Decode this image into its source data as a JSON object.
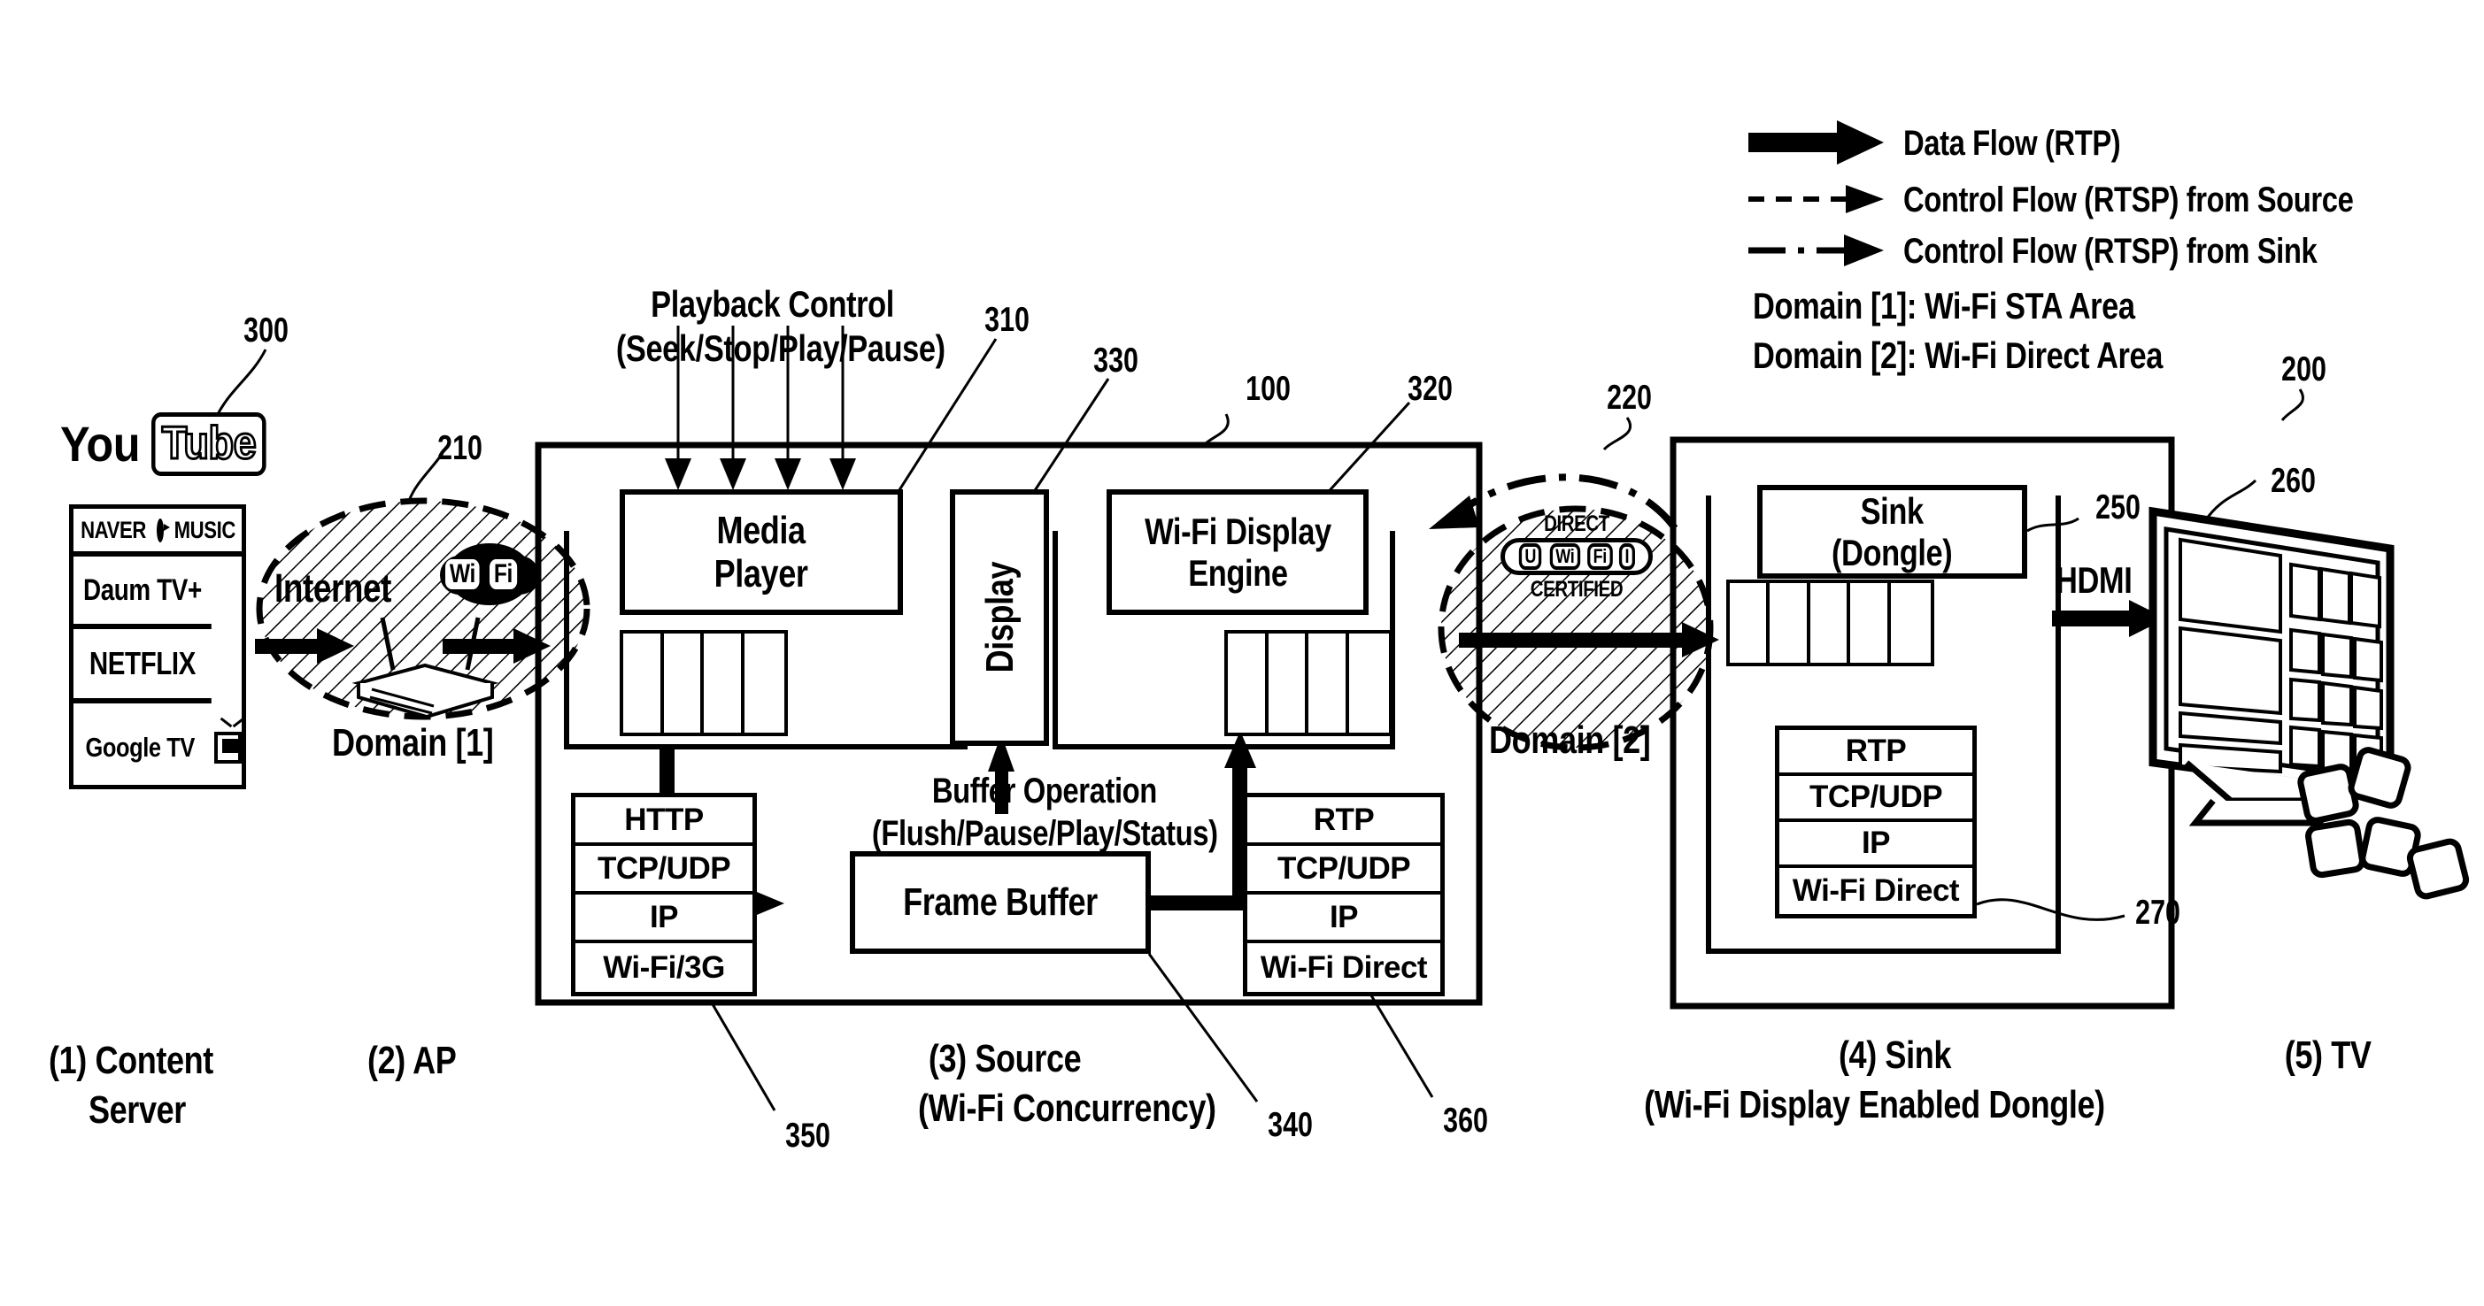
{
  "legend": {
    "items": [
      {
        "icon": "thick-block-arrow-icon",
        "label": "Data Flow (RTP)"
      },
      {
        "icon": "dashed-arrow-icon",
        "label": "Control Flow (RTSP) from Source"
      },
      {
        "icon": "dash-dot-arrow-icon",
        "label": "Control Flow (RTSP) from Sink"
      }
    ],
    "domains": [
      "Domain [1]: Wi-Fi STA Area",
      "Domain [2]: Wi-Fi Direct Area"
    ]
  },
  "content_server": {
    "ref": "300",
    "logo": "YouTube",
    "logo_part1": "You",
    "logo_part2": "Tube",
    "services": [
      "NAVER",
      "MUSIC",
      "Daum  TV+",
      "NETFLIX",
      "Google TV"
    ],
    "naver_left": "NAVER",
    "naver_right": "MUSIC",
    "daum": "Daum  TV+",
    "netflix": "NETFLIX",
    "googletv": "Google TV",
    "caption_line1": "(1) Content",
    "caption_line2": "Server"
  },
  "ap": {
    "ref": "210",
    "internet_label": "Internet",
    "wifi_badge": "Wi Fi",
    "wifi_badge_left": "Wi",
    "wifi_badge_right": "Fi",
    "domain_label": "Domain [1]",
    "caption": "(2) AP"
  },
  "source": {
    "ref": "100",
    "playback_control_line1": "Playback Control",
    "playback_control_line2": "(Seek/Stop/Play/Pause)",
    "media_player": {
      "ref": "310",
      "line1": "Media",
      "line2": "Player"
    },
    "display": {
      "ref": "330",
      "label": "Display"
    },
    "wifi_display_engine": {
      "ref": "320",
      "line1": "Wi-Fi Display",
      "line2": "Engine"
    },
    "buffer_operation_line1": "Buffer Operation",
    "buffer_operation_line2": "(Flush/Pause/Play/Status)",
    "frame_buffer": {
      "ref": "340",
      "label": "Frame Buffer"
    },
    "stack_left": {
      "ref": "350",
      "layers": [
        "HTTP",
        "TCP/UDP",
        "IP",
        "Wi-Fi/3G"
      ]
    },
    "stack_right": {
      "ref": "360",
      "layers": [
        "RTP",
        "TCP/UDP",
        "IP",
        "Wi-Fi Direct"
      ]
    },
    "caption_line1": "(3) Source",
    "caption_line2": "(Wi-Fi Concurrency)"
  },
  "direct_zone": {
    "ref": "220",
    "badge_top": "DIRECT",
    "badge_bottom": "CERTIFIED",
    "badge_mid_1": "U",
    "badge_mid_2": "Wi",
    "badge_mid_3": "Fi",
    "badge_mid_4": "I",
    "domain_label": "Domain [2]"
  },
  "sink": {
    "ref": "200",
    "dongle": {
      "ref": "250",
      "line1": "Sink",
      "line2": "(Dongle)"
    },
    "stack": {
      "ref": "270",
      "layers": [
        "RTP",
        "TCP/UDP",
        "IP",
        "Wi-Fi Direct"
      ]
    },
    "caption_line1": "(4) Sink",
    "caption_line2": "(Wi-Fi Display Enabled Dongle)"
  },
  "tv": {
    "ref": "260",
    "hdmi_label": "HDMI",
    "caption": "(5) TV"
  },
  "colors": {
    "ink": "#000000",
    "paper": "#ffffff"
  }
}
